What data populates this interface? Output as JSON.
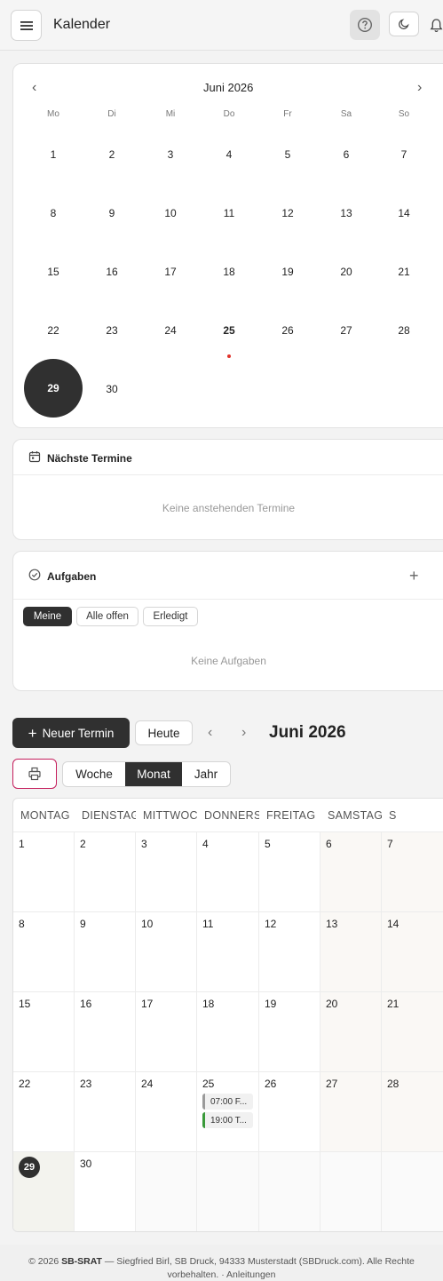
{
  "header": {
    "title": "Kalender",
    "menu_icon": "hamburger-icon",
    "help_icon": "question-circle-icon",
    "theme_icon": "moon-icon",
    "notif_icon": "bell-icon"
  },
  "mini_calendar": {
    "title": "Juni 2026",
    "weekdays": [
      "Mo",
      "Di",
      "Mi",
      "Do",
      "Fr",
      "Sa",
      "So"
    ],
    "weeks": [
      [
        "1",
        "2",
        "3",
        "4",
        "5",
        "6",
        "7"
      ],
      [
        "8",
        "9",
        "10",
        "11",
        "12",
        "13",
        "14"
      ],
      [
        "15",
        "16",
        "17",
        "18",
        "19",
        "20",
        "21"
      ],
      [
        "22",
        "23",
        "24",
        "25",
        "26",
        "27",
        "28"
      ],
      [
        "29",
        "30",
        "",
        "",
        "",
        "",
        ""
      ]
    ],
    "today": "29",
    "event_day": "25"
  },
  "next_events": {
    "title": "Nächste Termine",
    "empty": "Keine anstehenden Termine"
  },
  "tasks": {
    "title": "Aufgaben",
    "tabs": [
      "Meine",
      "Alle offen",
      "Erledigt"
    ],
    "active_tab": "Meine",
    "empty": "Keine Aufgaben"
  },
  "toolbar": {
    "new_label": "Neuer Termin",
    "today_label": "Heute",
    "title": "Juni 2026",
    "views": [
      "Woche",
      "Monat",
      "Jahr"
    ],
    "active_view": "Monat"
  },
  "month_grid": {
    "weekdays": [
      "MONTAG",
      "DIENSTAG",
      "MITTWOCH",
      "DONNERSTAG",
      "FREITAG",
      "SAMSTAG",
      "S"
    ],
    "weeks": [
      [
        "1",
        "2",
        "3",
        "4",
        "5",
        "6",
        "7"
      ],
      [
        "8",
        "9",
        "10",
        "11",
        "12",
        "13",
        "14"
      ],
      [
        "15",
        "16",
        "17",
        "18",
        "19",
        "20",
        "21"
      ],
      [
        "22",
        "23",
        "24",
        "25",
        "26",
        "27",
        "28"
      ],
      [
        "29",
        "30",
        "",
        "",
        "",
        "",
        ""
      ]
    ],
    "today": "29",
    "events": [
      {
        "day": "25",
        "label": "07:00 F...",
        "color": "#9a9a9a"
      },
      {
        "day": "25",
        "label": "19:00 T...",
        "color": "#3a9a3a"
      }
    ]
  },
  "footer": {
    "prefix": "© 2026",
    "brand": "SB-SRAT",
    "text": "— Siegfried Birl, SB Druck, 94333 Musterstadt (SBDruck.com). Alle Rechte vorbehalten. · Anleitungen"
  }
}
